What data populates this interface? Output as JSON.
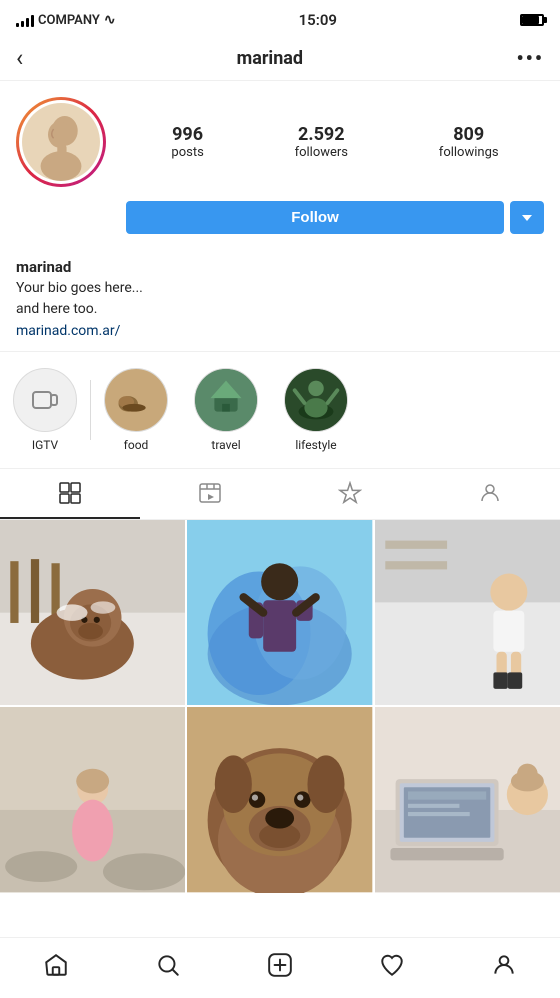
{
  "statusBar": {
    "carrier": "COMPANY",
    "time": "15:09"
  },
  "topNav": {
    "backLabel": "‹",
    "username": "marinad",
    "moreLabel": "•••"
  },
  "profile": {
    "stats": {
      "posts": {
        "value": "996",
        "label": "posts"
      },
      "followers": {
        "value": "2.592",
        "label": "followers"
      },
      "followings": {
        "value": "809",
        "label": "followings"
      }
    },
    "followButton": "Follow",
    "username": "marinad",
    "bio1": "Your bio goes here...",
    "bio2": "and here too.",
    "bioLink": "marinad.com.ar/"
  },
  "highlights": [
    {
      "label": "IGTV",
      "type": "igtv"
    },
    {
      "label": "food",
      "type": "food"
    },
    {
      "label": "travel",
      "type": "travel"
    },
    {
      "label": "lifestyle",
      "type": "lifestyle"
    }
  ],
  "tabs": [
    {
      "label": "grid",
      "icon": "grid-icon",
      "active": true
    },
    {
      "label": "reels",
      "icon": "reels-icon",
      "active": false
    },
    {
      "label": "tagged-saved",
      "icon": "star-icon",
      "active": false
    },
    {
      "label": "tagged",
      "icon": "person-icon",
      "active": false
    }
  ],
  "bottomNav": [
    {
      "label": "home",
      "icon": "home-icon"
    },
    {
      "label": "search",
      "icon": "search-icon"
    },
    {
      "label": "add",
      "icon": "add-icon"
    },
    {
      "label": "likes",
      "icon": "heart-icon"
    },
    {
      "label": "profile",
      "icon": "profile-icon"
    }
  ],
  "photos": [
    {
      "id": 1,
      "colors": [
        "#8B6347",
        "#C9956A",
        "#E8E0D5",
        "#A0785A",
        "#6B4A2E"
      ]
    },
    {
      "id": 2,
      "colors": [
        "#2E5C8A",
        "#7BA5C9",
        "#B5D4E8",
        "#1A3D5C",
        "#4A82B0"
      ]
    },
    {
      "id": 3,
      "colors": [
        "#D4C5B8",
        "#E8E2DC",
        "#B5A89A",
        "#8C7D72",
        "#F2EDE8"
      ]
    },
    {
      "id": 4,
      "colors": [
        "#E8D5C0",
        "#F5E6D3",
        "#D4B8A0",
        "#C9A882",
        "#B89070"
      ]
    },
    {
      "id": 5,
      "colors": [
        "#7A6047",
        "#B8956A",
        "#5A4530",
        "#9A7555",
        "#3D2E1A"
      ]
    },
    {
      "id": 6,
      "colors": [
        "#E8F0F5",
        "#C5D8E8",
        "#A0C0D5",
        "#D8EAF3",
        "#B5CEDF"
      ]
    }
  ]
}
